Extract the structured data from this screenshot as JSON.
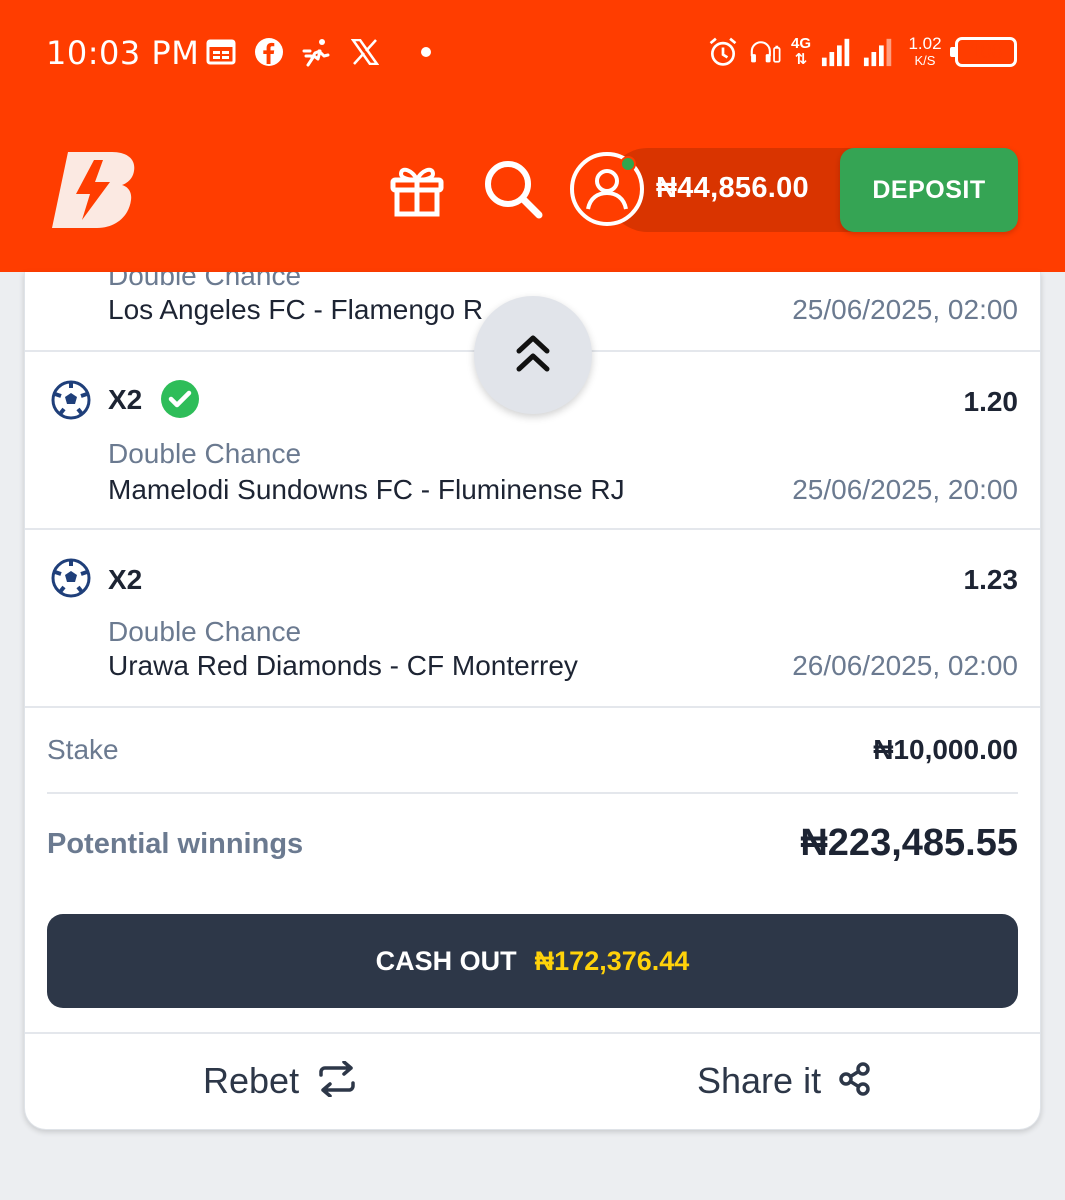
{
  "status_bar": {
    "time": "10:03 PM",
    "network": "4G",
    "speed_value": "1.02",
    "speed_unit": "K/S",
    "battery": "100"
  },
  "header": {
    "balance": "₦44,856.00",
    "deposit_label": "DEPOSIT"
  },
  "selections": [
    {
      "market": "Double Chance",
      "match": "Los Angeles FC - Flamengo R",
      "kickoff": "25/06/2025, 02:00"
    },
    {
      "pick": "X2",
      "odds": "1.20",
      "won": true,
      "market": "Double Chance",
      "match": "Mamelodi Sundowns FC - Fluminense RJ",
      "kickoff": "25/06/2025, 20:00"
    },
    {
      "pick": "X2",
      "odds": "1.23",
      "won": false,
      "market": "Double Chance",
      "match": "Urawa Red Diamonds - CF Monterrey",
      "kickoff": "26/06/2025, 02:00"
    }
  ],
  "summary": {
    "stake_label": "Stake",
    "stake_value": "₦10,000.00",
    "winnings_label": "Potential winnings",
    "winnings_value": "₦223,485.55"
  },
  "cashout": {
    "label": "CASH OUT",
    "amount": "₦172,376.44"
  },
  "footer": {
    "rebet_label": "Rebet",
    "share_label": "Share it"
  },
  "colors": {
    "brand": "#ff3d00",
    "deposit": "#35a454",
    "cashout_bg": "#2d3748",
    "cashout_amount": "#ffd20a",
    "won_check": "#2ebd59"
  },
  "icons": [
    "calendar-icon",
    "facebook-icon",
    "activity-icon",
    "x-icon",
    "alarm-icon",
    "headset-icon",
    "signal-icon",
    "battery-icon",
    "logo",
    "gift-icon",
    "search-icon",
    "user-icon",
    "chevron-double-up-icon",
    "soccer-ball-icon",
    "check-icon",
    "repeat-icon",
    "share-icon"
  ]
}
